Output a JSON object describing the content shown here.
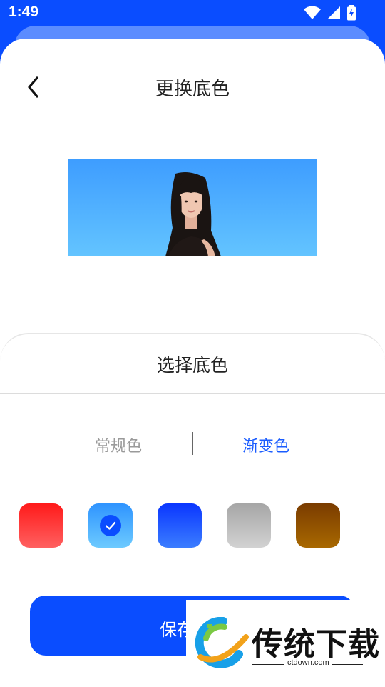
{
  "status_bar": {
    "time": "1:49",
    "icons": [
      "wifi-icon",
      "signal-icon",
      "battery-charging-icon"
    ]
  },
  "header": {
    "title": "更换底色",
    "back_icon": "chevron-left-icon"
  },
  "preview": {
    "background_gradient": [
      "#3e9dff",
      "#63c4ff"
    ]
  },
  "panel": {
    "title": "选择底色",
    "tabs": [
      {
        "label": "常规色",
        "active": false
      },
      {
        "label": "渐变色",
        "active": true
      }
    ],
    "swatches": [
      {
        "name": "red",
        "colors": [
          "#ff1a1a",
          "#ff6060"
        ],
        "selected": false
      },
      {
        "name": "light-blue",
        "colors": [
          "#2f94ff",
          "#6ccaff"
        ],
        "selected": true
      },
      {
        "name": "blue",
        "colors": [
          "#0a36ff",
          "#3b7dff"
        ],
        "selected": false
      },
      {
        "name": "gray",
        "colors": [
          "#a6a6a6",
          "#d2d2d2"
        ],
        "selected": false
      },
      {
        "name": "brown",
        "colors": [
          "#7a3c00",
          "#a86800"
        ],
        "selected": false
      }
    ]
  },
  "actions": {
    "save_label": "保存"
  },
  "watermark": {
    "text": "传统下载",
    "url": "ctdown.com"
  },
  "colors": {
    "accent": "#0a4dff",
    "tab_active": "#1a5cff",
    "tab_inactive": "#9a9a9a"
  }
}
